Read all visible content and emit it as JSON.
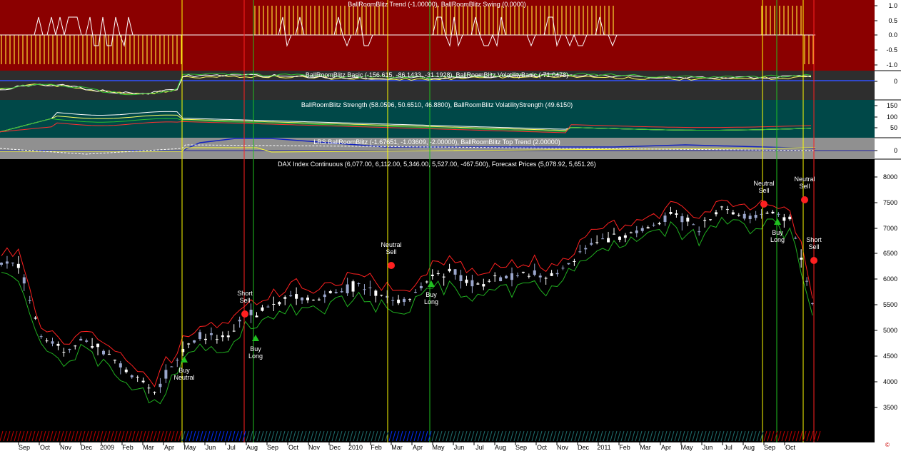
{
  "panes": {
    "trend": {
      "title": "BallRoomBlitz Trend (-1.00000), BallRoomBlitz Swing (0.0000)",
      "bg": "#8b0000",
      "ticks": [
        "1.0",
        "0.5",
        "0.0",
        "-0.5",
        "-1.0"
      ]
    },
    "basic": {
      "title": "BallRoomBlitz Basic (-156.615, -86.1433, -31.1928), BallRoomBlitz VolatilityBasic (-71.0478)",
      "bg": "#2e2e2e",
      "ticks": [
        "0"
      ]
    },
    "strength": {
      "title": "BallRoomBlitz Strength (58.0596, 50.6510, 46.8800), BallRoomBlitz VolatilityStrength (49.6150)",
      "bg": "#004848",
      "ticks": [
        "150",
        "100",
        "50"
      ]
    },
    "lrs": {
      "title": "LRS BallRoomBlitz (-1.67651, -1.03609, -2.00000), BallRoomBlitz Top Trend (2.00000)",
      "bg": "#909090",
      "ticks": [
        "0"
      ]
    },
    "price": {
      "title": "DAX Index Continuous (6,077.00, 6,112.00, 5,346.00, 5,527.00, -467.500), Forecast Prices (5,078.92, 5,651.26)",
      "bg": "#000000",
      "ticks": [
        "8000",
        "7500",
        "7000",
        "6500",
        "6000",
        "5500",
        "5000",
        "4500",
        "4000",
        "3500"
      ]
    }
  },
  "x_axis": {
    "labels": [
      "Sep",
      "Oct",
      "Nov",
      "Dec",
      "2009",
      "Feb",
      "Mar",
      "Apr",
      "May",
      "Jun",
      "Jul",
      "Aug",
      "Sep",
      "Oct",
      "Nov",
      "Dec",
      "2010",
      "Feb",
      "Mar",
      "Apr",
      "May",
      "Jun",
      "Jul",
      "Aug",
      "Sep",
      "Oct",
      "Nov",
      "Dec",
      "2011",
      "Feb",
      "Mar",
      "Apr",
      "May",
      "Jun",
      "Jul",
      "Aug",
      "Sep",
      "Oct"
    ]
  },
  "signals": [
    {
      "lines": [
        "Buy",
        "Neutral"
      ],
      "kind": "buy"
    },
    {
      "lines": [
        "Short",
        "Sell"
      ],
      "kind": "sell"
    },
    {
      "lines": [
        "Buy",
        "Long"
      ],
      "kind": "buy"
    },
    {
      "lines": [
        "Neutral",
        "Sell"
      ],
      "kind": "sell"
    },
    {
      "lines": [
        "Buy",
        "Long"
      ],
      "kind": "buy"
    },
    {
      "lines": [
        "Neutral",
        "Sell"
      ],
      "kind": "sell"
    },
    {
      "lines": [
        "Buy",
        "Long"
      ],
      "kind": "buy"
    },
    {
      "lines": [
        "Neutral",
        "Sell"
      ],
      "kind": "sell"
    },
    {
      "lines": [
        "Short",
        "Sell"
      ],
      "kind": "sell"
    }
  ],
  "colors": {
    "axis_bg": "#ffffff",
    "bull": "#ffffff",
    "bear": "#9aa6cc",
    "upper_band": "#ff2020",
    "lower_band": "#20b020",
    "vline_yellow": "#ffff00",
    "vline_red": "#ff2020",
    "vline_green": "#20c020"
  },
  "chart_data": {
    "type": "candlestick",
    "title": "DAX Index Continuous (6,077.00, 6,112.00, 5,346.00, 5,527.00, -467.500), Forecast Prices (5,078.92, 5,651.26)",
    "ylim": [
      3200,
      8300
    ],
    "x_range": [
      "2008-09",
      "2011-10"
    ],
    "last_bar": {
      "open": 6077.0,
      "high": 6112.0,
      "low": 5346.0,
      "close": 5527.0,
      "change": -467.5
    },
    "forecast_prices": [
      5078.92,
      5651.26
    ],
    "close_path": [
      {
        "month": "2008-09",
        "value": 6300
      },
      {
        "month": "2008-10",
        "value": 4900
      },
      {
        "month": "2008-11",
        "value": 4600
      },
      {
        "month": "2008-12",
        "value": 4800
      },
      {
        "month": "2009-01",
        "value": 4500
      },
      {
        "month": "2009-02",
        "value": 4100
      },
      {
        "month": "2009-03",
        "value": 3800
      },
      {
        "month": "2009-04",
        "value": 4500
      },
      {
        "month": "2009-05",
        "value": 4900
      },
      {
        "month": "2009-06",
        "value": 4800
      },
      {
        "month": "2009-07",
        "value": 5300
      },
      {
        "month": "2009-08",
        "value": 5450
      },
      {
        "month": "2009-09",
        "value": 5650
      },
      {
        "month": "2009-10",
        "value": 5600
      },
      {
        "month": "2009-11",
        "value": 5750
      },
      {
        "month": "2009-12",
        "value": 5900
      },
      {
        "month": "2010-01",
        "value": 5650
      },
      {
        "month": "2010-02",
        "value": 5550
      },
      {
        "month": "2010-03",
        "value": 6000
      },
      {
        "month": "2010-04",
        "value": 6200
      },
      {
        "month": "2010-05",
        "value": 5900
      },
      {
        "month": "2010-06",
        "value": 6000
      },
      {
        "month": "2010-07",
        "value": 6100
      },
      {
        "month": "2010-08",
        "value": 6050
      },
      {
        "month": "2010-09",
        "value": 6200
      },
      {
        "month": "2010-10",
        "value": 6600
      },
      {
        "month": "2010-11",
        "value": 6800
      },
      {
        "month": "2010-12",
        "value": 6900
      },
      {
        "month": "2011-01",
        "value": 7050
      },
      {
        "month": "2011-02",
        "value": 7300
      },
      {
        "month": "2011-03",
        "value": 7000
      },
      {
        "month": "2011-04",
        "value": 7400
      },
      {
        "month": "2011-05",
        "value": 7200
      },
      {
        "month": "2011-06",
        "value": 7300
      },
      {
        "month": "2011-07",
        "value": 7200
      },
      {
        "month": "2011-08",
        "value": 5500
      }
    ]
  }
}
